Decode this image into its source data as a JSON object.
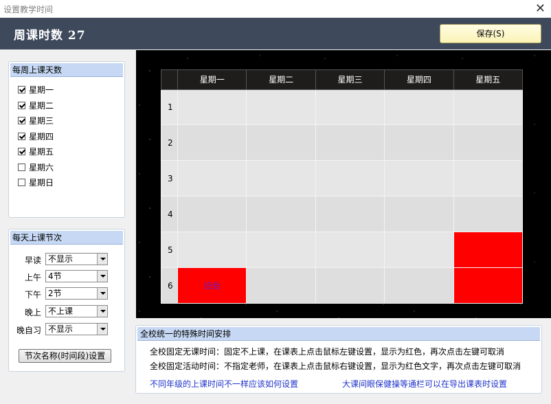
{
  "window": {
    "title": "设置教学时间",
    "close_glyph": "✕"
  },
  "header": {
    "weekly_hours": "周课时数 27",
    "save_label": "保存(S)"
  },
  "days_panel": {
    "title": "每周上课天数",
    "days": [
      {
        "label": "星期一",
        "checked": true
      },
      {
        "label": "星期二",
        "checked": true
      },
      {
        "label": "星期三",
        "checked": true
      },
      {
        "label": "星期四",
        "checked": true
      },
      {
        "label": "星期五",
        "checked": true
      },
      {
        "label": "星期六",
        "checked": false
      },
      {
        "label": "星期日",
        "checked": false
      }
    ]
  },
  "periods_panel": {
    "title": "每天上课节次",
    "rows": [
      {
        "label": "早读",
        "value": "不显示"
      },
      {
        "label": "上午",
        "value": "4节"
      },
      {
        "label": "下午",
        "value": "2节"
      },
      {
        "label": "晚上",
        "value": "不上课"
      },
      {
        "label": "晚自习",
        "value": "不显示"
      }
    ],
    "button_label": "节次名称(时间段)设置"
  },
  "timetable": {
    "columns": [
      "星期一",
      "星期二",
      "星期三",
      "星期四",
      "星期五"
    ],
    "rows": [
      "1",
      "2",
      "3",
      "4",
      "5",
      "6"
    ],
    "red_cells": [
      {
        "row": 5,
        "col": 5,
        "text": ""
      },
      {
        "row": 6,
        "col": 1,
        "text": "班会"
      },
      {
        "row": 6,
        "col": 5,
        "text": ""
      }
    ],
    "red_color": "#ff0000"
  },
  "notes": {
    "title": "全校统一的特殊时间安排",
    "line1": "全校固定无课时间：固定不上课，在课表上点击鼠标左键设置，显示为红色，再次点击左键可取消",
    "line2": "全校固定活动时间：不指定老师，在课表上点击鼠标右键设置，显示为红色文字，再次点击左键可取消",
    "link1": "不同年级的上课时间不一样应该如何设置",
    "link2": "大课间眼保健操等通栏可以在导出课表时设置"
  }
}
